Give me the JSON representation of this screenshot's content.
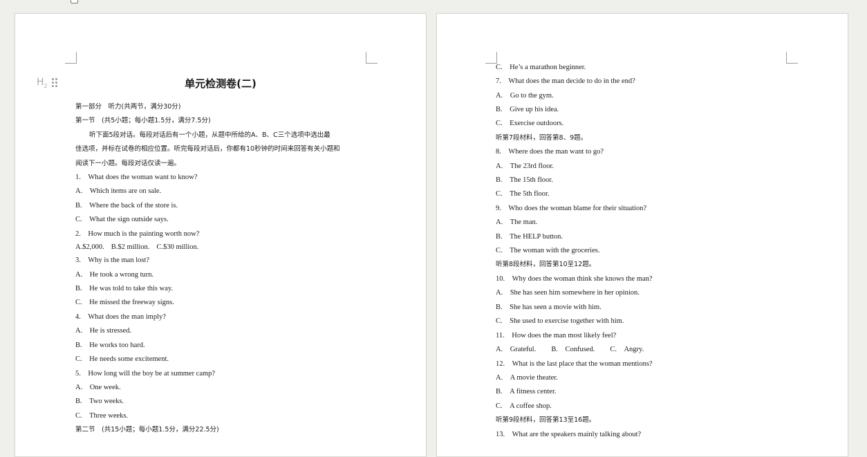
{
  "doc": {
    "title": "单元检测卷(二)",
    "heading_icon_label": "H2"
  },
  "page1": {
    "part1": "第一部分　听力(共两节，满分30分)",
    "section1": "第一节　(共5小题；每小题1.5分，满分7.5分)",
    "instr1": "听下面5段对话。每段对话后有一个小题，从题中所给的A、B、C三个选项中选出最",
    "instr2": "佳选项，并标在试卷的相应位置。听完每段对话后，你都有10秒钟的时间来回答有关小题和",
    "instr3": "阅读下一小题。每段对话仅读一遍。",
    "q1": "1.　What does the woman want to know?",
    "q1a": "A.　Which items are on sale.",
    "q1b": "B.　Where the back of the store is.",
    "q1c": "C.　What the sign outside says.",
    "q2": "2.　How much is the painting worth now?",
    "q2a": "A.$2,000.",
    "q2b": "B.$2 million.",
    "q2c": "C.$30 million.",
    "q3": "3.　Why is the man lost?",
    "q3a": "A.　He took a wrong turn.",
    "q3b": "B.　He was told to take this way.",
    "q3c": "C.　He missed the freeway signs.",
    "q4": "4.　What does the man imply?",
    "q4a": "A.　He is stressed.",
    "q4b": "B.　He works too hard.",
    "q4c": "C.　He needs some excitement.",
    "q5": "5.　How long will the boy be at summer camp?",
    "q5a": "A.　One week.",
    "q5b": "B.　Two weeks.",
    "q5c": "C.　Three weeks.",
    "section2": "第二节　(共15小题；每小题1.5分，满分22.5分)"
  },
  "page2": {
    "q6c": "C.　He’s a marathon beginner.",
    "q7": "7.　What does the man decide to do in the end?",
    "q7a": "A.　Go to the gym.",
    "q7b": "B.　Give up his idea.",
    "q7c": "C.　Exercise outdoors.",
    "m7": "听第7段材料，回答第8、9题。",
    "q8": "8.　Where does the man want to go?",
    "q8a": "A.　The 23rd floor.",
    "q8b": "B.　The 15th floor.",
    "q8c": "C.　The 5th floor.",
    "q9": "9.　Who does the woman blame for their situation?",
    "q9a": "A.　The man.",
    "q9b": "B.　The HELP button.",
    "q9c": "C.　The woman with the groceries.",
    "m8": "听第8段材料，回答第10至12题。",
    "q10": "10.　Why does the woman think she knows the man?",
    "q10a": "A.　She has seen him somewhere in her opinion.",
    "q10b": "B.　She has seen a movie with him.",
    "q10c": "C.　She used to exercise together with him.",
    "q11": "11.　How does the man most likely feel?",
    "q11a": "A.　Grateful.",
    "q11b": "B.　Confused.",
    "q11c": "C.　Angry.",
    "q12": "12.　What is the last place that the woman mentions?",
    "q12a": "A.　A movie theater.",
    "q12b": "B.　A fitness center.",
    "q12c": "C.　A coffee shop.",
    "m9": "听第9段材料，回答第13至16题。",
    "q13": "13.　What are the speakers mainly talking about?"
  }
}
